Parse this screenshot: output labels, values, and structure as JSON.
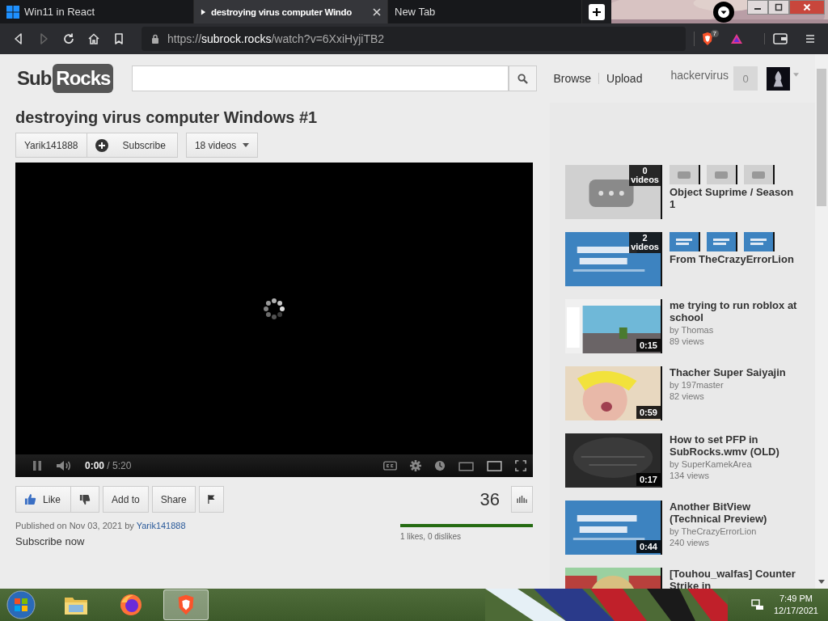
{
  "browser": {
    "tabs": [
      {
        "title": "Win11 in React",
        "selected": false,
        "kind": "windows"
      },
      {
        "title": "destroying virus computer Windo",
        "selected": true,
        "kind": "playing"
      },
      {
        "title": "New Tab",
        "selected": false,
        "kind": "blank"
      }
    ],
    "nav": [
      {
        "kind": "back",
        "disabled": false
      },
      {
        "kind": "forward",
        "disabled": true
      },
      {
        "kind": "reload",
        "disabled": false
      },
      {
        "kind": "home",
        "disabled": false
      },
      {
        "kind": "bookmark",
        "disabled": false
      }
    ],
    "url": {
      "scheme": "https://",
      "host": "subrock.rocks",
      "path": "/watch?v=6XxiHyjiTB2"
    },
    "shield_count": "7"
  },
  "site": {
    "logo": {
      "first": "Sub",
      "second": "Rocks"
    },
    "nav": [
      "Browse",
      "Upload"
    ],
    "user": {
      "name": "hackervirus",
      "count": "0"
    }
  },
  "video": {
    "title": "destroying virus computer Windows #1",
    "channel": "Yarik141888",
    "subscribe": "Subscribe",
    "videos_menu": "18 videos",
    "player": {
      "playing": true,
      "time_current": "0:00",
      "time_total": "/ 5:20"
    },
    "actions": [
      "Like",
      "Add to",
      "Share"
    ],
    "views": "36",
    "rating": {
      "level": 1,
      "text": "1 likes, 0 dislikes"
    },
    "published": "Published on Nov 03, 2021 by",
    "author_link": "Yarik141888",
    "subscribe_now": "Subscribe now"
  },
  "sidebar": [
    {
      "kind": "playlist",
      "count": "0",
      "count_label": "videos",
      "title": "Object Suprime / Season 1"
    },
    {
      "kind": "playlist",
      "count": "2",
      "count_label": "videos",
      "title": "From TheCrazyErrorLion"
    },
    {
      "kind": "video",
      "title": "me trying to run roblox at school",
      "by": "by Thomas",
      "views": "89 views",
      "duration": "0:15"
    },
    {
      "kind": "video",
      "title": "Thacher Super Saiyajin",
      "by": "by 197master",
      "views": "82 views",
      "duration": "0:59"
    },
    {
      "kind": "video",
      "title": "How to set PFP in SubRocks.wmv (OLD)",
      "by": "by SuperKamekArea",
      "views": "134 views",
      "duration": "0:17"
    },
    {
      "kind": "video",
      "title": "Another BitView (Technical Preview)",
      "by": "by TheCrazyErrorLion",
      "views": "240 views",
      "duration": "0:44"
    },
    {
      "kind": "cut",
      "title": "[Touhou_walfas] Counter Strike in"
    }
  ],
  "taskbar": {
    "apps": [
      {
        "kind": "folder",
        "selected": false
      },
      {
        "kind": "firefox",
        "selected": false
      },
      {
        "kind": "brave",
        "selected": true
      }
    ],
    "time": "7:49 PM",
    "date": "12/17/2021"
  }
}
